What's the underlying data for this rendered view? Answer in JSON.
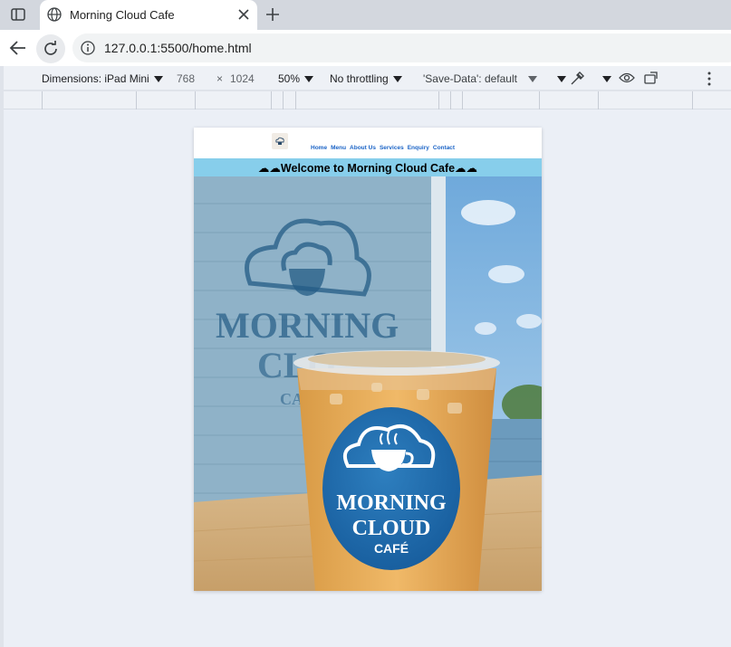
{
  "browser": {
    "tab_title": "Morning Cloud Cafe",
    "url": "127.0.0.1:5500/home.html"
  },
  "device_toolbar": {
    "dimensions_label": "Dimensions: iPad Mini",
    "width": "768",
    "times": "×",
    "height": "1024",
    "zoom": "50%",
    "throttling": "No throttling",
    "save_data": "'Save-Data': default"
  },
  "site": {
    "nav": [
      "Home",
      "Menu",
      "About Us",
      "Services",
      "Enquiry",
      "Contact"
    ],
    "welcome": "☁☁Welcome to Morning Cloud Cafe☁☁",
    "welcome_color": "#87ceeb",
    "nav_color": "#1a63c6",
    "cup_logo": {
      "line1": "MORNING",
      "line2": "CLOUD",
      "line3": "CAFÉ"
    },
    "wall_sign": {
      "line1": "MORNING",
      "line2": "CLO",
      "line3": "CA"
    }
  }
}
